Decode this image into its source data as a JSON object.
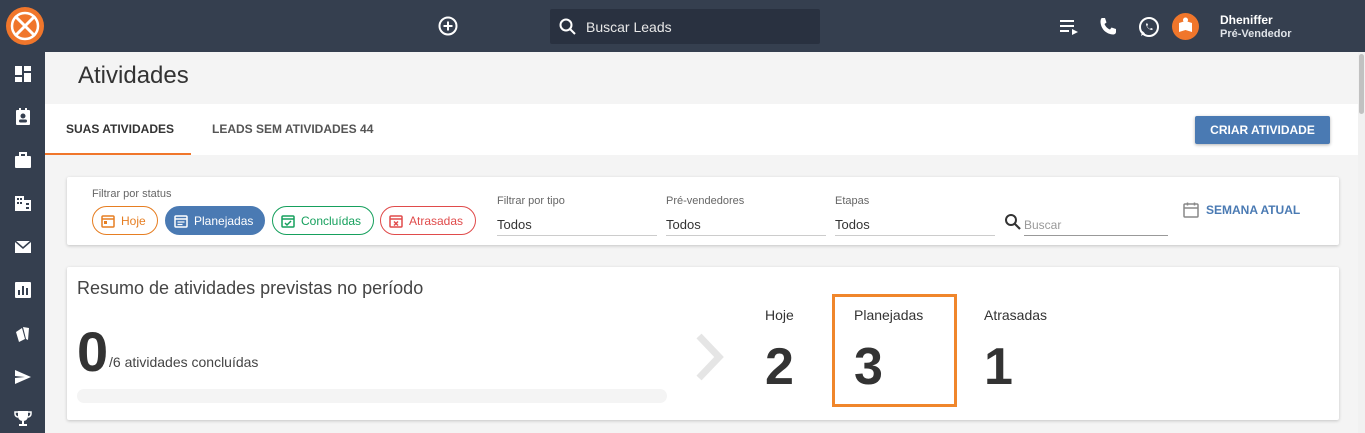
{
  "topbar": {
    "search_placeholder": "Buscar Leads",
    "user_name": "Dheniffer",
    "user_role": "Pré-Vendedor"
  },
  "page": {
    "title": "Atividades"
  },
  "tabs": [
    {
      "label": "SUAS ATIVIDADES"
    },
    {
      "label": "LEADS SEM ATIVIDADES 44"
    }
  ],
  "create_button": "CRIAR ATIVIDADE",
  "filters": {
    "status_label": "Filtrar por status",
    "chips": [
      {
        "label": "Hoje"
      },
      {
        "label": "Planejadas"
      },
      {
        "label": "Concluídas"
      },
      {
        "label": "Atrasadas"
      }
    ],
    "type_label": "Filtrar por tipo",
    "type_value": "Todos",
    "presellers_label": "Pré-vendedores",
    "presellers_value": "Todos",
    "stages_label": "Etapas",
    "stages_value": "Todos",
    "search_placeholder": "Buscar",
    "week_button": "SEMANA ATUAL"
  },
  "summary": {
    "title": "Resumo de atividades previstas no período",
    "completed": "0",
    "completed_text": "/6 atividades concluídas",
    "progress_fraction": 0,
    "stats": [
      {
        "label": "Hoje",
        "value": "2"
      },
      {
        "label": "Planejadas",
        "value": "3"
      },
      {
        "label": "Atrasadas",
        "value": "1"
      }
    ]
  },
  "colors": {
    "topbar": "#353f4f",
    "accent": "#f0762b",
    "primary": "#4a7ab3",
    "success": "#16a05d",
    "danger": "#e04b4b"
  }
}
